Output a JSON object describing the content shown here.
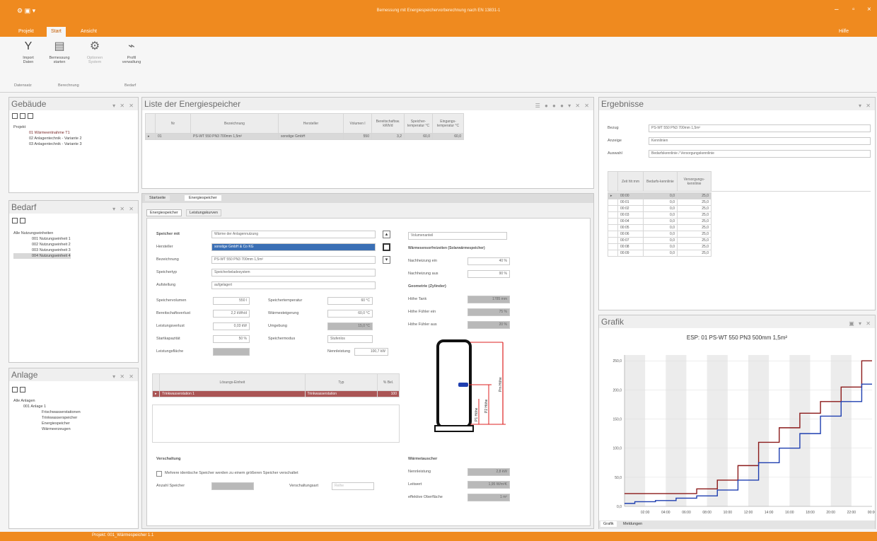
{
  "window": {
    "title": "Bemessung mit Energiespeichervorberechnung nach EN 13831-1"
  },
  "ribbon": {
    "tabs": [
      "Projekt",
      "Start",
      "Ansicht"
    ],
    "active_tab": "Start",
    "right_label": "Hilfe",
    "buttons": [
      {
        "label": "Import\nDaten"
      },
      {
        "label": "Bemessung\nstarten"
      },
      {
        "label": "Optionen\nSystem"
      },
      {
        "label": "Profil\nverwaltung"
      }
    ],
    "groups": [
      "Datensatz",
      "Berechnung",
      "Bedarf"
    ]
  },
  "left": {
    "gebaeude": {
      "title": "Gebäude",
      "items": [
        "Projekt",
        "01 Wärmeentnahme T1",
        "02 Anlagentechnik - Variante 2",
        "03 Anlagentechnik - Variante 3"
      ]
    },
    "bedarf": {
      "title": "Bedarf",
      "items": [
        "Alle Nutzungseinheiten",
        "001 Nutzungseinheit 1",
        "002 Nutzungseinheit 2",
        "003 Nutzungseinheit 3",
        "004 Nutzungseinheit 4"
      ]
    },
    "anlage": {
      "title": "Anlage",
      "items": [
        "Alle Anlagen",
        "001 Anlage 1",
        "Frischwasserstationen",
        "Trinkwasserspeicher",
        "Energiespeicher",
        "Wärmeerzeugen"
      ]
    }
  },
  "liste": {
    "title": "Liste der Energiespeicher",
    "headers": [
      "Nr",
      "Bezeichnung",
      "Hersteller",
      "Volumen l",
      "Bereitschaftsw. kWh/d",
      "Speicher-temperatur °C",
      "Eingangs-temperatur °C"
    ],
    "row": [
      "01",
      "PS-WT 550 PN3 700mm 1,5m²",
      "sonstige GmbH",
      "550",
      "3,2",
      "60,0",
      "60,0"
    ]
  },
  "editor": {
    "doc_tabs": [
      "Startseite",
      "Energiespeicher"
    ],
    "sub_tabs": [
      "Energiespeicher",
      "Leistungskurven"
    ],
    "labels": {
      "speicher": "Speicher mit",
      "hersteller": "Hersteller",
      "bezeichnung": "Bezeichnung",
      "speichertyp": "Speichertyp",
      "aufstellung": "Aufstellung",
      "speichervolumen": "Speichervolumen",
      "bereitschaft": "Bereitschaftsverlust",
      "leistungsverlust": "Leistungsverlust",
      "startkapazitaet": "Startkapazität",
      "leistungsflaeche": "Leistungsfläche",
      "speichertemp": "Speichertemperatur",
      "waermesteigerung": "Wärmesteigerung",
      "umgebung": "Umgebung",
      "speichermodus": "Speichermodus",
      "neuerleistung": "Nennleistung",
      "verschaltung": "Verschaltung",
      "checkbox": "Mehrere identische Speicher werden zu einem größeren Speicher verschaltet",
      "anzahl": "Anzahl Speicher",
      "verschaltungsart": "Verschaltungsart"
    },
    "values": {
      "speicher": "Wärme der Anlagennutzung",
      "hersteller": "sonstige GmbH & Co KG",
      "bezeichnung": "PS-WT 550 PN3 700mm 1,5m²",
      "speichertyp": "Speicherbeladesystem",
      "aufstellung": "aufgelagert",
      "speichervolumen": "550 l",
      "bereitschaft": "2,2 kWh/d",
      "leistungsverlust": "0,03 kW",
      "startkapazitaet": "50 %",
      "speichertemp": "60 °C",
      "waermesteigerung": "60,0 °C",
      "umgebung": "15,0 °C",
      "speichermodus": "Stufenlos",
      "neuerleistung": "100,7 kW",
      "verschaltungsart": "Reihe"
    },
    "subgrid": {
      "headers": [
        "Lösungs-Einheit",
        "Typ",
        "% Bel."
      ],
      "row": [
        "Trinkwasserstation 1",
        "Trinkwasserstation",
        "100"
      ]
    },
    "right_labels": {
      "dropdown": "Volumenanteil",
      "waerme_title": "Wärmesensorfreizeiten (Solarwärmespeicher)",
      "ein": "Nachheizung ein",
      "aus": "Nachheizung aus",
      "geo_title": "Geometrie (Zylinder)",
      "hoehe": "Höhe Tank",
      "fuehler_ein": "Höhe Fühler ein",
      "fuehler_aus": "Höhe Fühler aus",
      "tauscher_title": "Wärmetauscher",
      "nennleistung": "Nennleistung",
      "leitwert": "Leitwert",
      "flaeche": "effektive Oberfläche"
    },
    "right_values": {
      "ein": "40 %",
      "aus": "90 %",
      "hoehe": "1785 mm",
      "fuehler_ein": "75 %",
      "fuehler_aus": "20 %",
      "nennleistung": "2,8 kW",
      "leitwert": "1,95 W/m²K",
      "flaeche": "1 m²"
    },
    "diagram_labels": [
      "P1 Höhe",
      "P2 Höhe",
      "Pm Höhe"
    ]
  },
  "ergebnisse": {
    "title": "Ergebnisse",
    "bezug_label": "Bezug",
    "bezug": "PS-WT 550 PN3 700mm 1,5m²",
    "anzeige_label": "Anzeige",
    "anzeige": "Kennlinien",
    "auswahl_label": "Auswahl",
    "auswahl": "Bedarfskennlinie / Versorgungskennlinie",
    "headers": [
      "Zeit hh:mm",
      "Bedarfs-kennlinie",
      "Versorgungs-kennlinie"
    ],
    "rows": [
      [
        "00:00",
        "0,0",
        "25,0"
      ],
      [
        "00:01",
        "0,0",
        "25,0"
      ],
      [
        "00:02",
        "0,0",
        "25,0"
      ],
      [
        "00:03",
        "0,0",
        "25,0"
      ],
      [
        "00:04",
        "0,0",
        "25,0"
      ],
      [
        "00:05",
        "0,0",
        "25,0"
      ],
      [
        "00:06",
        "0,0",
        "25,0"
      ],
      [
        "00:07",
        "0,0",
        "25,0"
      ],
      [
        "00:08",
        "0,0",
        "25,0"
      ],
      [
        "00:09",
        "0,0",
        "25,0"
      ]
    ]
  },
  "grafik": {
    "title": "Grafik",
    "bottom_tabs": [
      "Grafik",
      "Meldungen"
    ]
  },
  "status": {
    "text": "Projekt: 001_Wärmespeicher 1.1"
  },
  "colors": {
    "accent": "#ef8a1f",
    "series_red": "#8b1a1a",
    "series_blue": "#1f3fb0"
  },
  "chart_data": {
    "type": "line",
    "title": "ESP: 01 PS-WT 550 PN3 500mm 1,5m²",
    "x": [
      "00:00",
      "02:00",
      "04:00",
      "06:00",
      "08:00",
      "10:00",
      "12:00",
      "14:00",
      "16:00",
      "18:00",
      "20:00",
      "22:00",
      "24:00"
    ],
    "ytick_labels": [
      "0,0",
      "50,0",
      "100,0",
      "150,0",
      "200,0",
      "250,0"
    ],
    "xtick_labels": [
      "02:00",
      "04:00",
      "06:00",
      "08:00",
      "10:00",
      "12:00",
      "14:00",
      "16:00",
      "18:00",
      "20:00",
      "22:00",
      "00:00"
    ],
    "ylim": [
      0,
      260
    ],
    "series": [
      {
        "color": "#8b1a1a",
        "values": [
          22,
          22,
          22,
          22,
          30,
          45,
          70,
          110,
          135,
          160,
          180,
          205,
          250
        ]
      },
      {
        "color": "#1f3fb0",
        "values": [
          5,
          8,
          10,
          14,
          18,
          28,
          45,
          75,
          100,
          125,
          155,
          180,
          210
        ]
      }
    ]
  }
}
